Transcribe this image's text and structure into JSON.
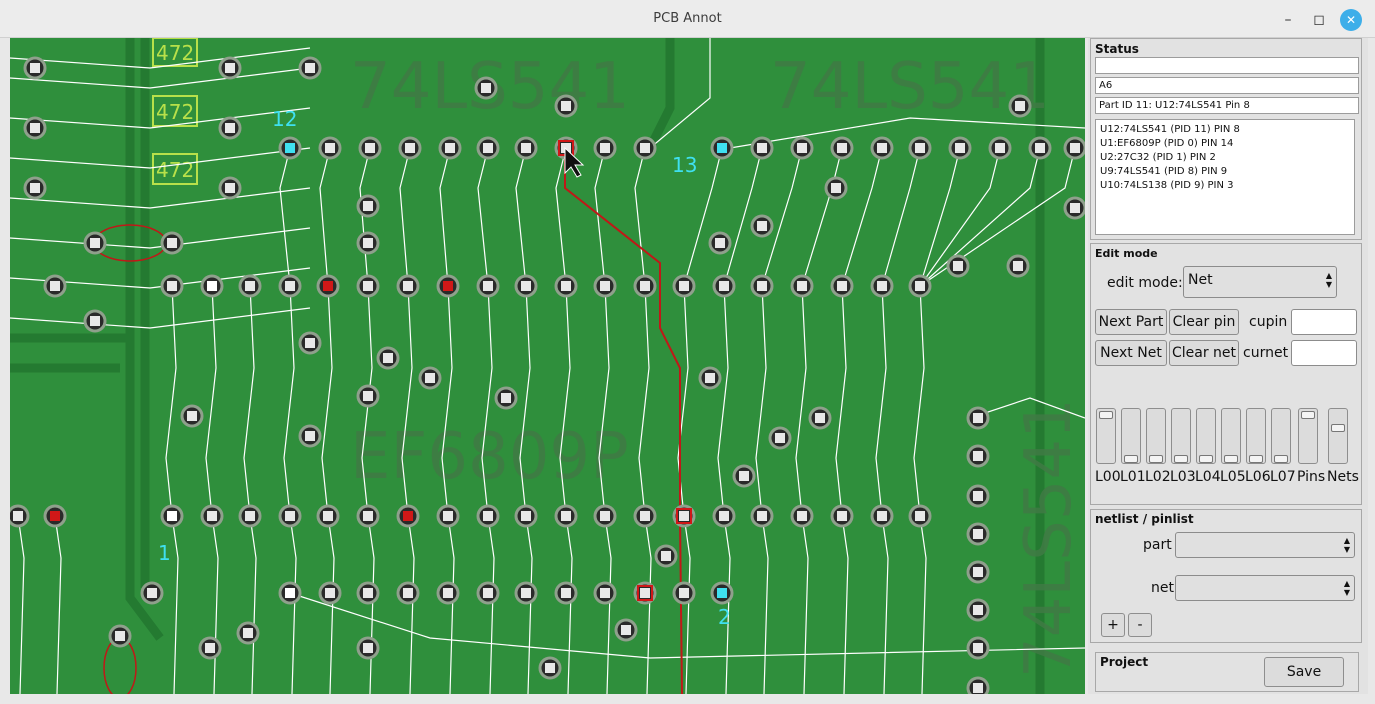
{
  "window": {
    "title": "PCB Annot",
    "controls": {
      "minimize": "–",
      "maximize": "◻",
      "close": "✕"
    }
  },
  "board": {
    "silkscreen": {
      "chip_a": "74LS541",
      "chip_b": "74LS541",
      "chip_c": "EF6809P",
      "chip_d": "74LS541"
    },
    "resistors": [
      "472",
      "472",
      "472"
    ],
    "pin_labels": {
      "p12": "12",
      "p13": "13",
      "p1": "1",
      "p2": "2"
    },
    "colors": {
      "board": "#2f8f3c",
      "trace": "#ffffff",
      "net": "#c01818",
      "marker_cyan": "#3fe0f0",
      "silk_text": "#b8e04a"
    }
  },
  "status": {
    "title": "Status",
    "field1": "",
    "field2": "A6",
    "field3": "Part ID 11: U12:74LS541 Pin 8",
    "pins": [
      "U12:74LS541 (PID 11) PIN 8",
      "U1:EF6809P (PID 0) PIN 14",
      "U2:27C32 (PID 1) PIN 2",
      "U9:74LS541 (PID 8) PIN 9",
      "U10:74LS138 (PID 9) PIN 3"
    ]
  },
  "edit": {
    "title": "Edit mode",
    "mode_label": "edit mode:",
    "mode_value": "Net",
    "next_part": "Next Part",
    "clear_pin": "Clear pin",
    "cupin_label": "cupin",
    "next_net": "Next Net",
    "clear_net": "Clear net",
    "curnet_label": "curnet",
    "layers": [
      "L00",
      "L01",
      "L02",
      "L03",
      "L04",
      "L05",
      "L06",
      "L07",
      "Pins",
      "Nets"
    ],
    "layer_levels": [
      1,
      0,
      0,
      0,
      0,
      0,
      0,
      0,
      1,
      0.7
    ]
  },
  "netlist": {
    "title": "netlist / pinlist",
    "part_label": "part",
    "part_value": "",
    "net_label": "net",
    "net_value": "",
    "add": "+",
    "remove": "-"
  },
  "project": {
    "title": "Project",
    "save": "Save"
  }
}
